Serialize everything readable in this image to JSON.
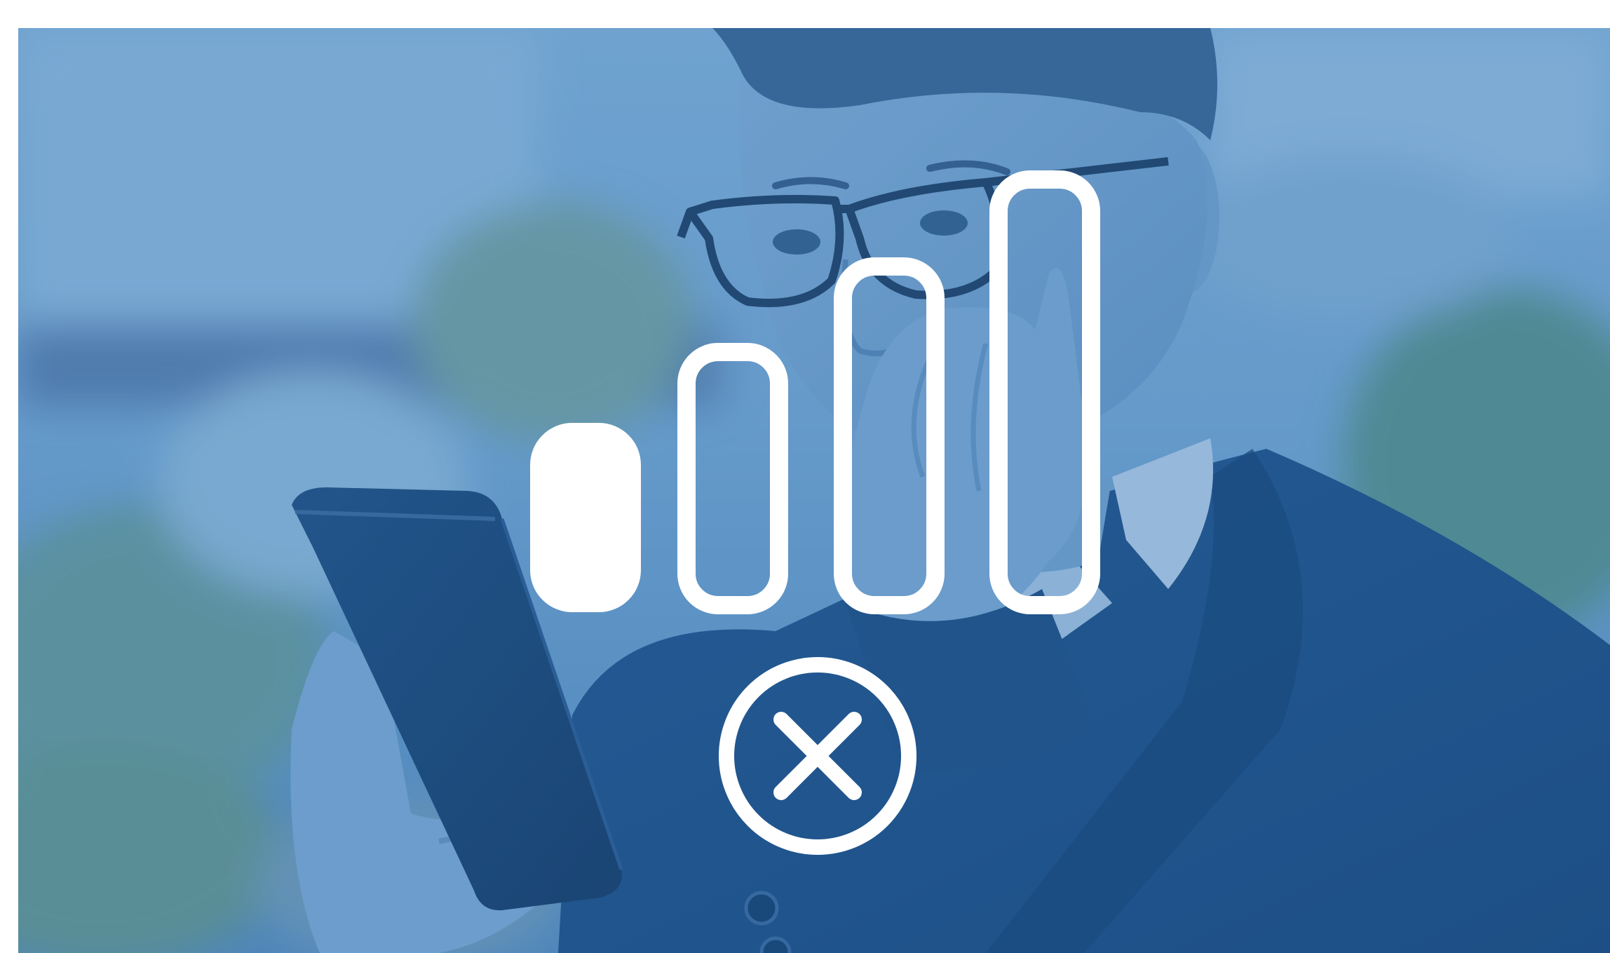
{
  "image": {
    "overlay_color": "#2f74b3",
    "icon_color": "#ffffff",
    "icons": {
      "signal": "signal-strength-icon",
      "status": "no-connection-x-icon"
    },
    "signal_level": {
      "filled_bars": 1,
      "total_bars": 4
    }
  }
}
